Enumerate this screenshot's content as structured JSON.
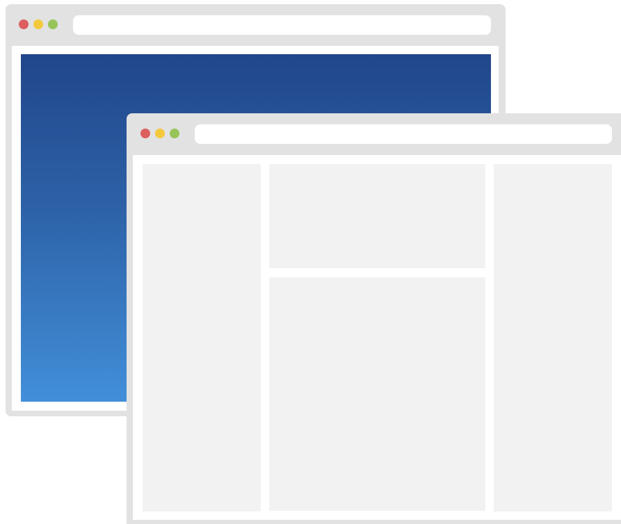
{
  "windows": [
    {
      "id": "back",
      "controls": [
        "close",
        "minimize",
        "maximize"
      ],
      "address_bar": {
        "value": ""
      },
      "content": "gradient-hero"
    },
    {
      "id": "front",
      "controls": [
        "close",
        "minimize",
        "maximize"
      ],
      "address_bar": {
        "value": ""
      },
      "content": "three-column-layout"
    }
  ],
  "colors": {
    "chrome": "#e2e2e2",
    "close": "#dc5f5f",
    "minimize": "#f5c93e",
    "maximize": "#97c459",
    "panel": "#f2f2f2",
    "gradient_top": "#21468a",
    "gradient_bottom": "#428fd9"
  }
}
